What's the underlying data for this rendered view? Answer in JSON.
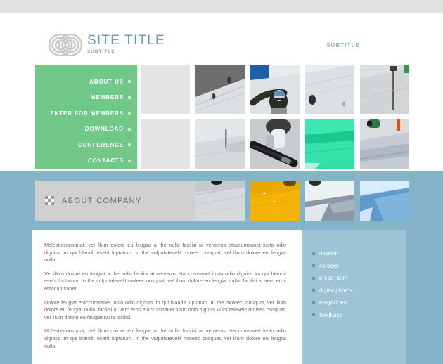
{
  "header": {
    "logo_icon": "overlapping-rings-logo",
    "site_title": "SITE TITLE",
    "site_subtitle": "SUBTITLE",
    "header_link": "SUBTITLE"
  },
  "nav": {
    "items": [
      {
        "label": "ABOUT US"
      },
      {
        "label": "MEMBERS"
      },
      {
        "label": "ENTER FOR MEMBERS"
      },
      {
        "label": "DOWNLOAD"
      },
      {
        "label": "CONFERENCE"
      },
      {
        "label": "CONTACTS"
      }
    ]
  },
  "gallery": {
    "row1": [
      {
        "type": "placeholder"
      },
      {
        "type": "photo",
        "alt": "snowboarder on slope",
        "tone": "gray"
      },
      {
        "type": "photo",
        "alt": "snowboarder with helmet and goggles",
        "tone": "blue-sky"
      },
      {
        "type": "photo",
        "alt": "snowy slope with rider",
        "tone": "white"
      },
      {
        "type": "photo",
        "alt": "ski lift pole on slope",
        "tone": "gray"
      }
    ],
    "row2": [
      {
        "type": "placeholder"
      },
      {
        "type": "photo",
        "alt": "snow field with marker pole",
        "tone": "white"
      },
      {
        "type": "photo",
        "alt": "snowboard close up",
        "tone": "gray"
      },
      {
        "type": "photo",
        "alt": "green tinted snow slope",
        "tone": "green"
      },
      {
        "type": "photo",
        "alt": "rider jumping near flag",
        "tone": "blue"
      }
    ],
    "row3": [
      {
        "type": "photo",
        "alt": "tracks in snow",
        "tone": "gray"
      },
      {
        "type": "photo",
        "alt": "yellow tinted snow texture",
        "tone": "yellow"
      },
      {
        "type": "photo",
        "alt": "snow slope with shadow",
        "tone": "white"
      },
      {
        "type": "photo",
        "alt": "blue tinted snow drift",
        "tone": "blue"
      }
    ]
  },
  "about": {
    "section_icon": "checkerboard-icon",
    "section_title": "ABOUT COMPANY",
    "paragraphs": [
      "Molestieconsquat, vel illum dolore eu feugiat a the nulla facilisi at veroeros etaccumsanet iusto odio digniss im qui blandit esent luptatum. In the vulputatevelit moleec onsquat, vel illum dolore eu feugiat nulla.",
      "Vel illum dolore eu feugiat a the nulla facilisi at veroeros etaccumsanet iusto odio digniss im qui blandit esent luptatum. In the vulputatevelit moleec onsquat, vel illum dolore eu feugiat nulla, facilisi at vero eros etaccumsanet.",
      "Dolore feugiat   etaccumsanet iusto odio digniss im qui blandit luptatum. In the moleec. onsquat, vel illum dolore eu feugiat nulla, facilisi at vero eros etaccumsanet iusto odio digniss vulputatevelit moleec onsquat, vel illum dolore eu feugiat nulla facilisi.",
      "Molestieconsquat, vel illum dolore eu feugiat a the nulla facilisi at veroeros etaccumsanet iusto odio digniss im qui blandit esent luptatum. In the vulputatevelit moleec onsquat, vel illum dolore eu feugiat nulla."
    ]
  },
  "sidebar": {
    "items": [
      {
        "label": "mission"
      },
      {
        "label": "careers"
      },
      {
        "label": "press room"
      },
      {
        "label": "digital photos"
      },
      {
        "label": "magazines"
      },
      {
        "label": "feedback"
      }
    ]
  },
  "colors": {
    "nav_green": "#72c888",
    "band_blue": "#85b4c9",
    "sidebar_blue": "#9dc3d5",
    "title_blue": "#6f9ab4",
    "header_gray": "#d0d0d0",
    "top_band_gray": "#e2e2e2"
  }
}
